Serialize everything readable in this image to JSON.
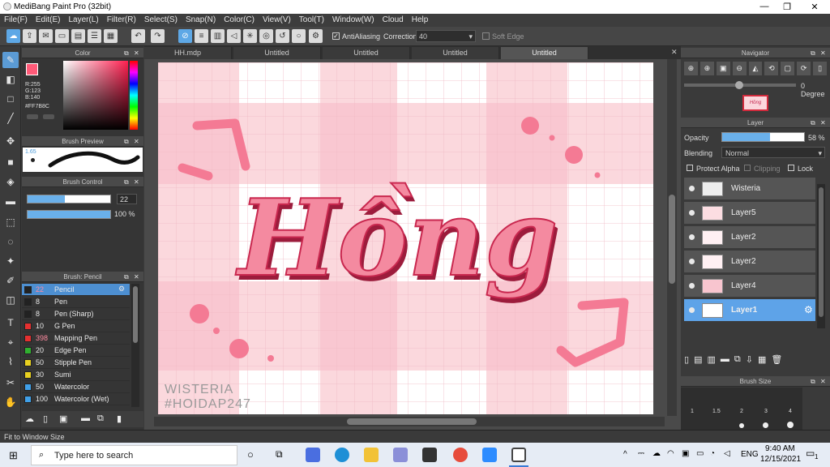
{
  "window": {
    "title": "MediBang Paint Pro (32bit)"
  },
  "menu": [
    "File(F)",
    "Edit(E)",
    "Layer(L)",
    "Filter(R)",
    "Select(S)",
    "Snap(N)",
    "Color(C)",
    "View(V)",
    "Tool(T)",
    "Window(W)",
    "Cloud",
    "Help"
  ],
  "toolbar": {
    "antialiasing_label": "AntiAliasing",
    "correction_label": "Correction",
    "correction_value": "40",
    "soft_edge_label": "Soft Edge"
  },
  "color_panel": {
    "title": "Color",
    "rgb": "R:255\nG:123\nB:140",
    "hex": "#FF7B8C",
    "fg": "#ff5a78"
  },
  "brush_preview": {
    "title": "Brush Preview",
    "size": "1.65"
  },
  "brush_control": {
    "title": "Brush Control",
    "size": "22",
    "opacity": "100 %",
    "size_fill": 0.45
  },
  "brush_list": {
    "title": "Brush: Pencil",
    "items": [
      {
        "size": "22",
        "name": "Pencil",
        "color": "#222222",
        "selected": true
      },
      {
        "size": "8",
        "name": "Pen",
        "color": "#222222"
      },
      {
        "size": "8",
        "name": "Pen (Sharp)",
        "color": "#222222"
      },
      {
        "size": "10",
        "name": "G Pen",
        "color": "#e53030"
      },
      {
        "size": "398",
        "name": "Mapping Pen",
        "color": "#e53030"
      },
      {
        "size": "20",
        "name": "Edge Pen",
        "color": "#30b030"
      },
      {
        "size": "50",
        "name": "Stipple Pen",
        "color": "#e8d020"
      },
      {
        "size": "30",
        "name": "Sumi",
        "color": "#e8d020"
      },
      {
        "size": "50",
        "name": "Watercolor",
        "color": "#40a0e8"
      },
      {
        "size": "100",
        "name": "Watercolor (Wet)",
        "color": "#40a0e8"
      }
    ]
  },
  "tabs": [
    "HH.mdp",
    "Untitled",
    "Untitled",
    "Untitled",
    "Untitled"
  ],
  "canvas": {
    "main_text": "Hồng",
    "signature_1": "WISTERIA",
    "signature_2": "#HOIDAP247",
    "accent": "#f27a93"
  },
  "navigator": {
    "title": "Navigator",
    "rotation": "0 Degree"
  },
  "layer_panel": {
    "title": "Layer",
    "opacity_label": "Opacity",
    "opacity_value": "58 %",
    "opacity_fill": 0.58,
    "blending_label": "Blending",
    "blending_value": "Normal",
    "protect_alpha": "Protect Alpha",
    "clipping": "Clipping",
    "lock": "Lock",
    "layers": [
      {
        "name": "Wisteria"
      },
      {
        "name": "Layer5"
      },
      {
        "name": "Layer2"
      },
      {
        "name": "Layer2"
      },
      {
        "name": "Layer4"
      },
      {
        "name": "Layer1",
        "selected": true
      }
    ]
  },
  "brush_size_panel": {
    "title": "Brush Size",
    "labels": [
      "1",
      "1.5",
      "2",
      "3",
      "4"
    ]
  },
  "status": {
    "text": "Fit to Window Size"
  },
  "taskbar": {
    "search_placeholder": "Type here to search",
    "lang": "ENG",
    "time": "9:40 AM",
    "date": "12/15/2021",
    "notif": "1"
  }
}
